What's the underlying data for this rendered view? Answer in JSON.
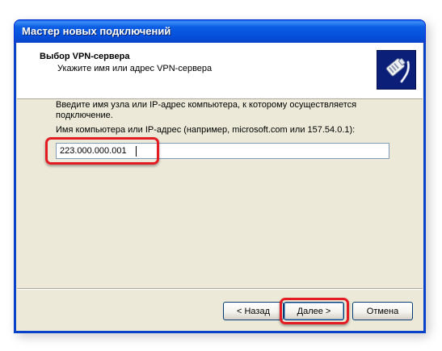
{
  "window": {
    "title": "Мастер новых подключений"
  },
  "header": {
    "title": "Выбор VPN-сервера",
    "subtitle": "Укажите имя или адрес VPN-сервера",
    "icon": "network-plug-icon"
  },
  "body": {
    "instructions": "Введите имя узла или IP-адрес компьютера, к которому осуществляется подключение.",
    "host_label": "Имя компьютера или IP-адрес (например, microsoft.com или 157.54.0.1):",
    "host_value": "223.000.000.001"
  },
  "buttons": {
    "back": "< Назад",
    "next": "Далее >",
    "cancel": "Отмена"
  },
  "colors": {
    "titlebar": "#0550dc",
    "dialog_bg": "#ece9d8",
    "highlight": "#e31b23"
  }
}
